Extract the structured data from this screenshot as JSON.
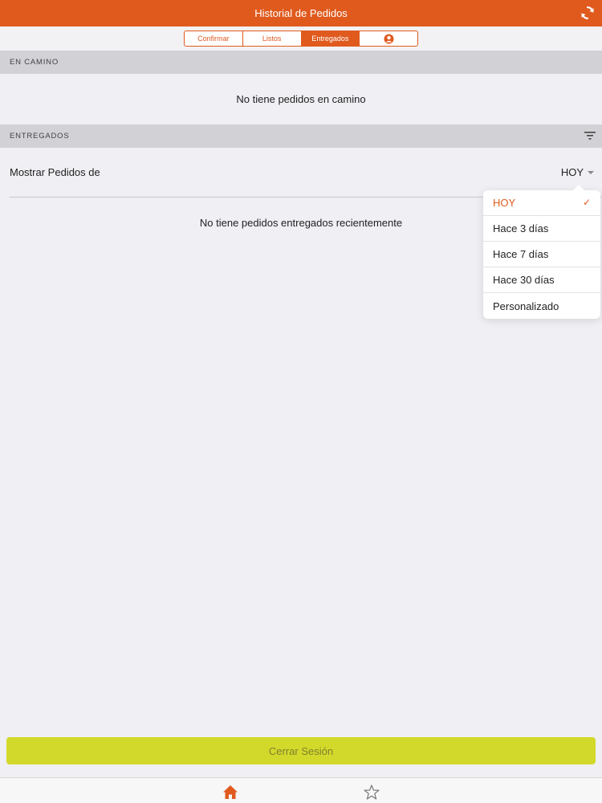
{
  "header": {
    "title": "Historial de Pedidos",
    "refresh_icon": "refresh-icon"
  },
  "segments": {
    "items": [
      {
        "label": "Confirmar",
        "active": false
      },
      {
        "label": "Listos",
        "active": false
      },
      {
        "label": "Entregados",
        "active": true
      }
    ],
    "profile_icon": "user-icon"
  },
  "en_camino": {
    "title": "EN CAMINO",
    "empty_text": "No tiene pedidos en camino"
  },
  "entregados": {
    "title": "ENTREGADOS",
    "filter_icon": "filter-icon",
    "show_label": "Mostrar Pedidos de",
    "show_value": "HOY",
    "empty_text": "No tiene pedidos entregados recientemente"
  },
  "dropdown": {
    "options": [
      {
        "label": "HOY",
        "selected": true
      },
      {
        "label": "Hace 3 días",
        "selected": false
      },
      {
        "label": "Hace 7 días",
        "selected": false
      },
      {
        "label": "Hace 30 días",
        "selected": false
      },
      {
        "label": "Personalizado",
        "selected": false
      }
    ],
    "check_mark": "✓"
  },
  "footer": {
    "logout_label": "Cerrar Sesión"
  },
  "tab_bar": {
    "tabs": [
      "home-icon",
      "star-icon"
    ]
  },
  "colors": {
    "accent": "#e05a1e",
    "logout_bg": "#d3d92a",
    "background": "#efeff4"
  }
}
